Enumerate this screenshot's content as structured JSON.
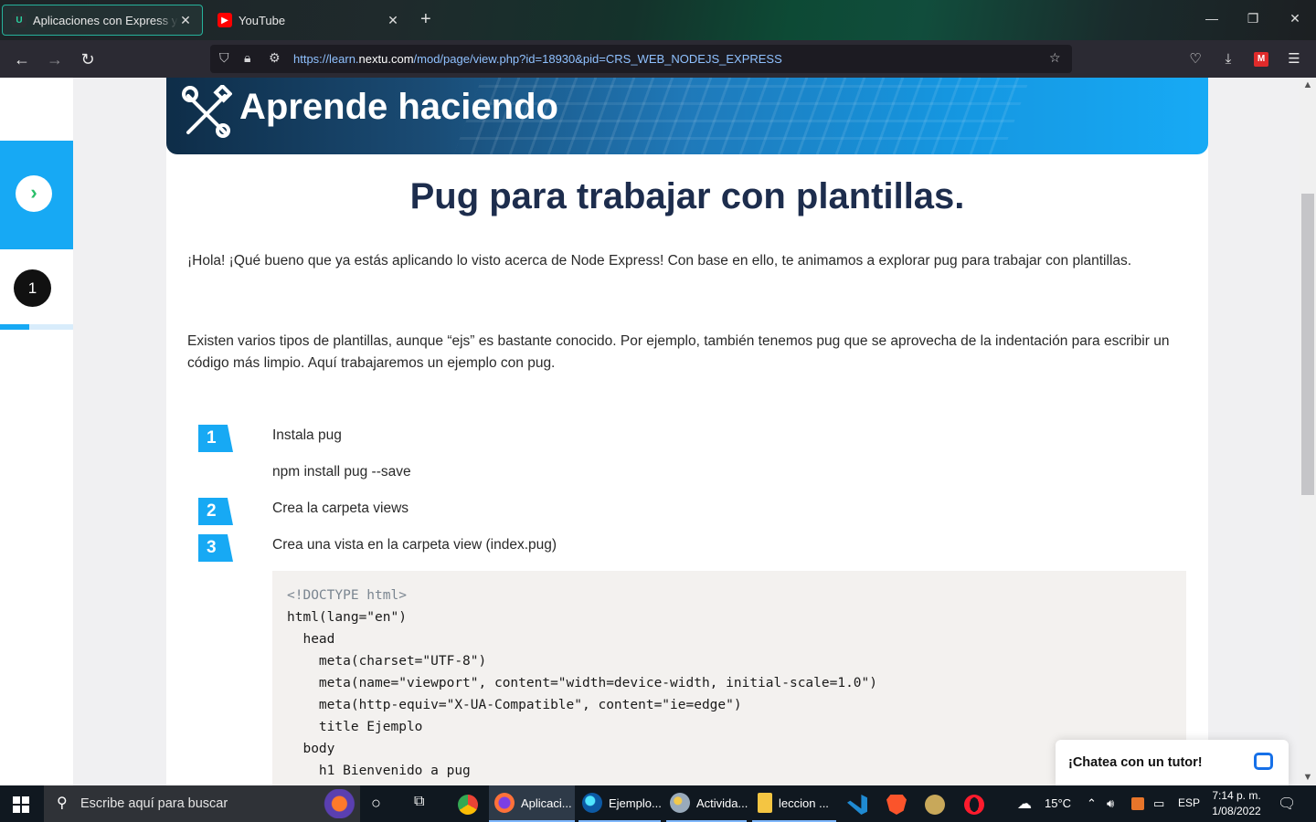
{
  "browser": {
    "tabs": [
      {
        "title": "Aplicaciones con Express y Node",
        "favicon": "U",
        "active": true
      },
      {
        "title": "YouTube",
        "favicon": "▶",
        "active": false
      }
    ],
    "url_prefix": "https://learn.",
    "url_domain": "nextu.com",
    "url_path": "/mod/page/view.php?id=18930&pid=CRS_WEB_NODEJS_EXPRESS"
  },
  "sidebar": {
    "step_number": "1",
    "progress_fraction": 0.4
  },
  "banner": {
    "title": "Aprende haciendo"
  },
  "content": {
    "heading": "Pug para trabajar con plantillas.",
    "paragraph1": "¡Hola! ¡Qué bueno que ya estás aplicando lo visto acerca de Node Express! Con base en ello, te animamos a explorar pug para trabajar con plantillas.",
    "paragraph2": "Existen varios tipos de plantillas, aunque “ejs” es bastante conocido. Por ejemplo, también tenemos pug que se aprovecha de la indentación para escribir un código más limpio.  Aquí trabajaremos un ejemplo con pug.",
    "steps": [
      {
        "num": "1",
        "text": "Instala pug",
        "sub": "npm install pug --save"
      },
      {
        "num": "2",
        "text": "Crea la carpeta views"
      },
      {
        "num": "3",
        "text": "Crea una vista en la carpeta view (index.pug)"
      }
    ],
    "code_lines": [
      "<!DOCTYPE html>",
      "html(lang=\"en\")",
      "  head",
      "    meta(charset=\"UTF-8\")",
      "    meta(name=\"viewport\", content=\"width=device-width, initial-scale=1.0\")",
      "    meta(http-equiv=\"X-UA-Compatible\", content=\"ie=edge\")",
      "    title Ejemplo",
      "  body",
      "    h1 Bienvenido a pug"
    ]
  },
  "chat": {
    "label": "¡Chatea con un tutor!"
  },
  "taskbar": {
    "search_placeholder": "Escribe aquí para buscar",
    "apps": [
      "Aplicaci...",
      "Ejemplo...",
      "Activida...",
      "leccion ..."
    ],
    "weather": "15°C",
    "language": "ESP",
    "time": "7:14 p. m.",
    "date": "1/08/2022"
  },
  "colors": {
    "accent": "#17a9f4",
    "heading": "#1d2d4d",
    "success": "#2cbf6b"
  }
}
